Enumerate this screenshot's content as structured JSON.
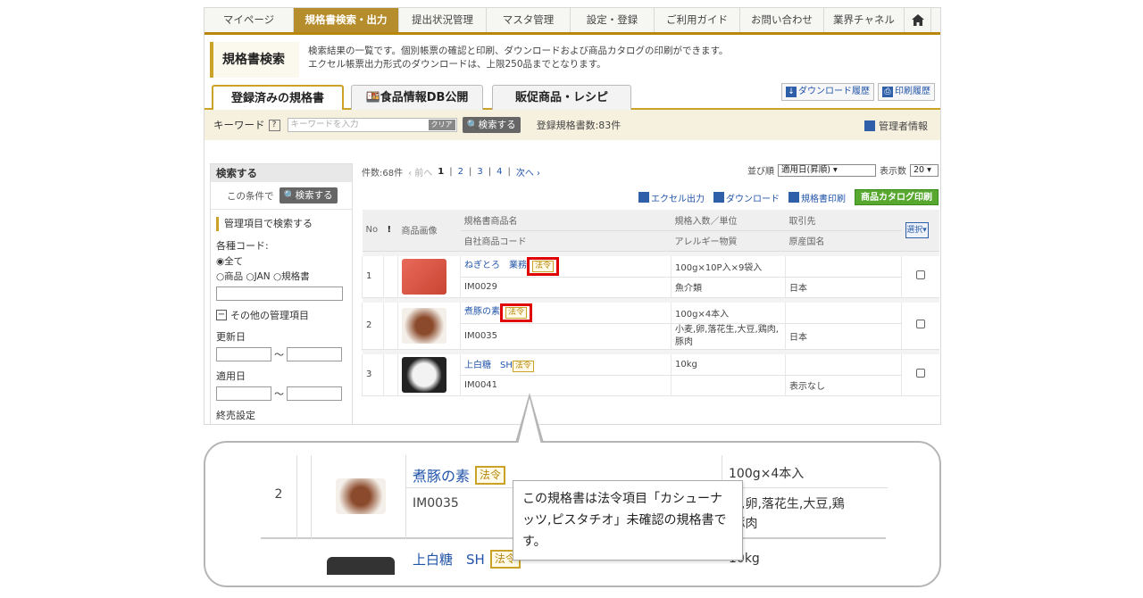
{
  "nav": {
    "items": [
      "マイページ",
      "規格書検索・出力",
      "提出状況管理",
      "マスタ管理",
      "設定・登録",
      "ご利用ガイド",
      "お問い合わせ",
      "業界チャネル"
    ],
    "active_index": 1
  },
  "header": {
    "title": "規格書検索",
    "desc_line1": "検索結果の一覧です。個別帳票の確認と印刷、ダウンロードおよび商品カタログの印刷ができます。",
    "desc_line2": "エクセル帳票出力形式のダウンロードは、上限250品までとなります。"
  },
  "tabs": {
    "items": [
      "登録済みの規格書",
      "食品情報DB公開",
      "販促商品・レシピ"
    ],
    "download_history": "ダウンロード履歴",
    "print_history": "印刷履歴"
  },
  "keyword": {
    "label": "キーワード",
    "help": "?",
    "placeholder": "キーワードを入力",
    "clear": "クリア",
    "search": "検索する",
    "count": "登録規格書数:83件",
    "admin": "管理者情報"
  },
  "left": {
    "head": "検索する",
    "cond_label": "この条件で",
    "search_btn": "検索する",
    "section_mgmt": "管理項目で検索する",
    "code_label": "各種コード:",
    "radio_all": "◉全て",
    "radio_others": "○商品 ○JAN ○規格書",
    "other_items": "その他の管理項目",
    "toggle_symbol": "−",
    "updated": "更新日",
    "applied": "適用日",
    "tilde": "〜",
    "end_setting": "終売設定"
  },
  "results": {
    "count": "件数:68件",
    "prev": "‹ 前へ",
    "pages": [
      "1",
      "2",
      "3",
      "4"
    ],
    "next": "次へ ›",
    "sort_label": "並び順",
    "sort_value": "適用日(昇順)",
    "per_page_label": "表示数",
    "per_page_value": "20",
    "excel": "エクセル出力",
    "download": "ダウンロード",
    "print": "規格書印刷",
    "catalog": "商品カタログ印刷",
    "columns": {
      "no": "No",
      "mark": "!",
      "image": "商品画像",
      "name": "規格書商品名",
      "code": "自社商品コード",
      "qty": "規格入数／単位",
      "allergy": "アレルギー物質",
      "supplier": "取引先",
      "origin": "原産国名",
      "select": "選択▾"
    },
    "houri": "法令",
    "rows": [
      {
        "no": "1",
        "name": "ねぎとろ　業務",
        "code": "IM0029",
        "qty": "100g×10P入×9袋入",
        "allergy": "魚介類",
        "origin": "日本"
      },
      {
        "no": "2",
        "name": "煮豚の素",
        "code": "IM0035",
        "qty": "100g×4本入",
        "allergy": "小麦,卵,落花生,大豆,鶏肉,豚肉",
        "origin": "日本"
      },
      {
        "no": "3",
        "name": "上白糖　SH",
        "code": "IM0041",
        "qty": "10kg",
        "allergy": "",
        "origin": "表示なし"
      }
    ]
  },
  "zoom": {
    "no": "2",
    "name": "煮豚の素",
    "houri": "法令",
    "code": "IM0035",
    "qty": "100g×4本入",
    "allergy_line1": "麦,卵,落花生,大豆,鶏",
    "allergy_line2": ",豚肉",
    "next_name": "上白糖　SH",
    "next_houri": "法令",
    "next_qty": "10kg",
    "tooltip": "この規格書は法令項目「カシューナッツ,ピスタチオ」未確認の規格書です。"
  },
  "colors": {
    "accent": "#b68d2c",
    "link": "#2255aa",
    "highlight": "#e00000",
    "catalog_button": "#58a830"
  }
}
